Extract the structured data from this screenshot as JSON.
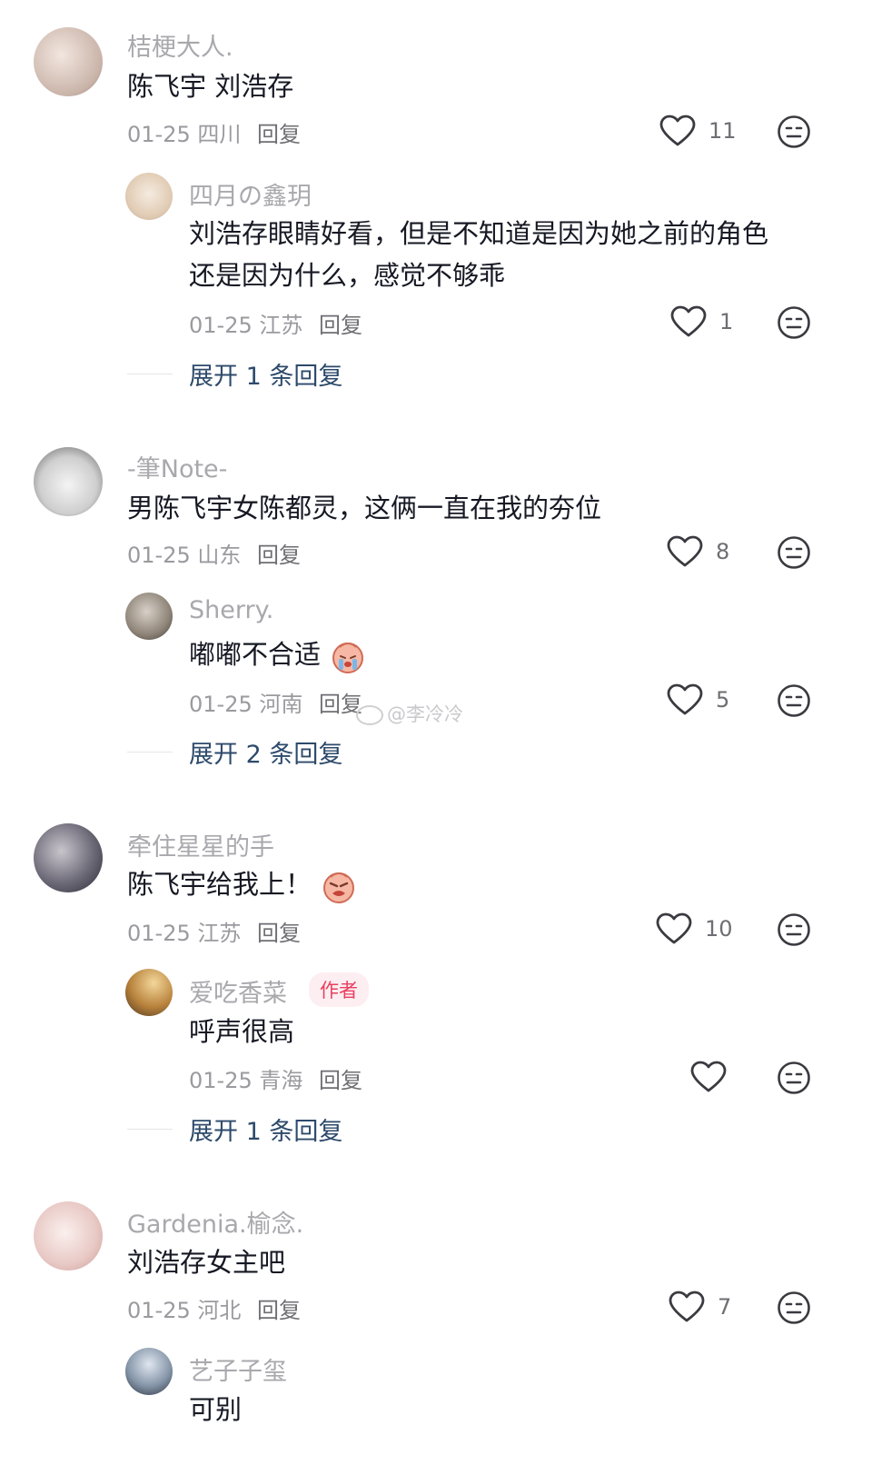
{
  "comments": [
    {
      "user": "桔梗大人.",
      "text": "陈飞宇 刘浩存",
      "date": "01-25",
      "location": "四川",
      "reply": "回复",
      "likes": "11",
      "reply_item": {
        "user": "四月の鑫玥",
        "text_line1": "刘浩存眼睛好看，但是不知道是因为她之前的角色",
        "text_line2": "还是因为什么，感觉不够乖",
        "date": "01-25",
        "location": "江苏",
        "reply": "回复",
        "likes": "1"
      },
      "expand": "展开 1 条回复"
    },
    {
      "user": "-筆Note-",
      "text": "男陈飞宇女陈都灵，这俩一直在我的夯位",
      "date": "01-25",
      "location": "山东",
      "reply": "回复",
      "likes": "8",
      "reply_item": {
        "user": "Sherry.",
        "text": "嘟嘟不合适",
        "date": "01-25",
        "location": "河南",
        "reply": "回复",
        "likes": "5"
      },
      "expand": "展开 2 条回复"
    },
    {
      "user": "牵住星星的手",
      "text": "陈飞宇给我上！",
      "date": "01-25",
      "location": "江苏",
      "reply": "回复",
      "likes": "10",
      "reply_item": {
        "user": "爱吃香菜",
        "badge": "作者",
        "text": "呼声很高",
        "date": "01-25",
        "location": "青海",
        "reply": "回复",
        "likes": ""
      },
      "expand": "展开 1 条回复"
    },
    {
      "user": "Gardenia.榆念.",
      "text": "刘浩存女主吧",
      "date": "01-25",
      "location": "河北",
      "reply": "回复",
      "likes": "7",
      "reply_item": {
        "user": "艺子子玺",
        "text": "可别"
      }
    }
  ],
  "watermark": "@李冷冷",
  "icons": {
    "like": "heart-outline-icon",
    "dislike": "meh-face-icon"
  },
  "colors": {
    "accent_link": "#2d4a6b",
    "author_badge": "#e84060"
  }
}
